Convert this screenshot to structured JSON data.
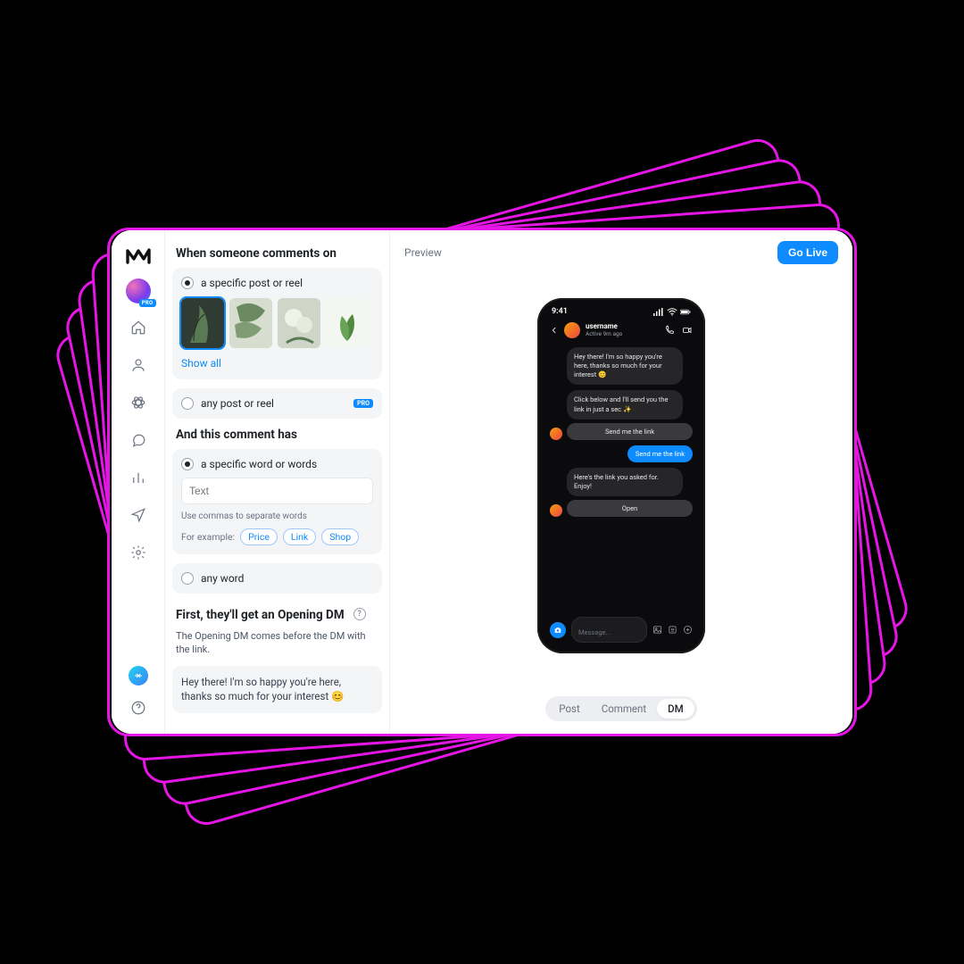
{
  "sidebar": {
    "pro_badge": "PRO"
  },
  "editor": {
    "trigger_heading": "When someone comments on",
    "option_specific": "a specific post or reel",
    "show_all": "Show all",
    "option_any": "any post or reel",
    "pro_chip": "PRO",
    "condition_heading": "And this comment has",
    "option_words": "a specific word or words",
    "text_placeholder": "Text",
    "hint": "Use commas to separate words",
    "example_prefix": "For example:",
    "tags": [
      "Price",
      "Link",
      "Shop"
    ],
    "option_anyword": "any word",
    "opening_heading": "First, they'll get an Opening DM",
    "opening_sub": "The Opening DM comes before the DM with the link.",
    "opening_text": "Hey there! I'm so happy you're here, thanks so much for your interest 😊"
  },
  "right": {
    "preview": "Preview",
    "go_live": "Go Live",
    "tabs": {
      "post": "Post",
      "comment": "Comment",
      "dm": "DM"
    }
  },
  "phone": {
    "time": "9:41",
    "username": "username",
    "status": "Active 9m ago",
    "msg1": "Hey there! I'm so happy you're here, thanks so much for your interest 😊",
    "msg2": "Click below and I'll send you the link in just a sec ✨",
    "btn1": "Send me the link",
    "out1": "Send me the link",
    "msg3": "Here's the link you asked for. Enjoy!",
    "btn2": "Open",
    "compose": "Message..."
  }
}
